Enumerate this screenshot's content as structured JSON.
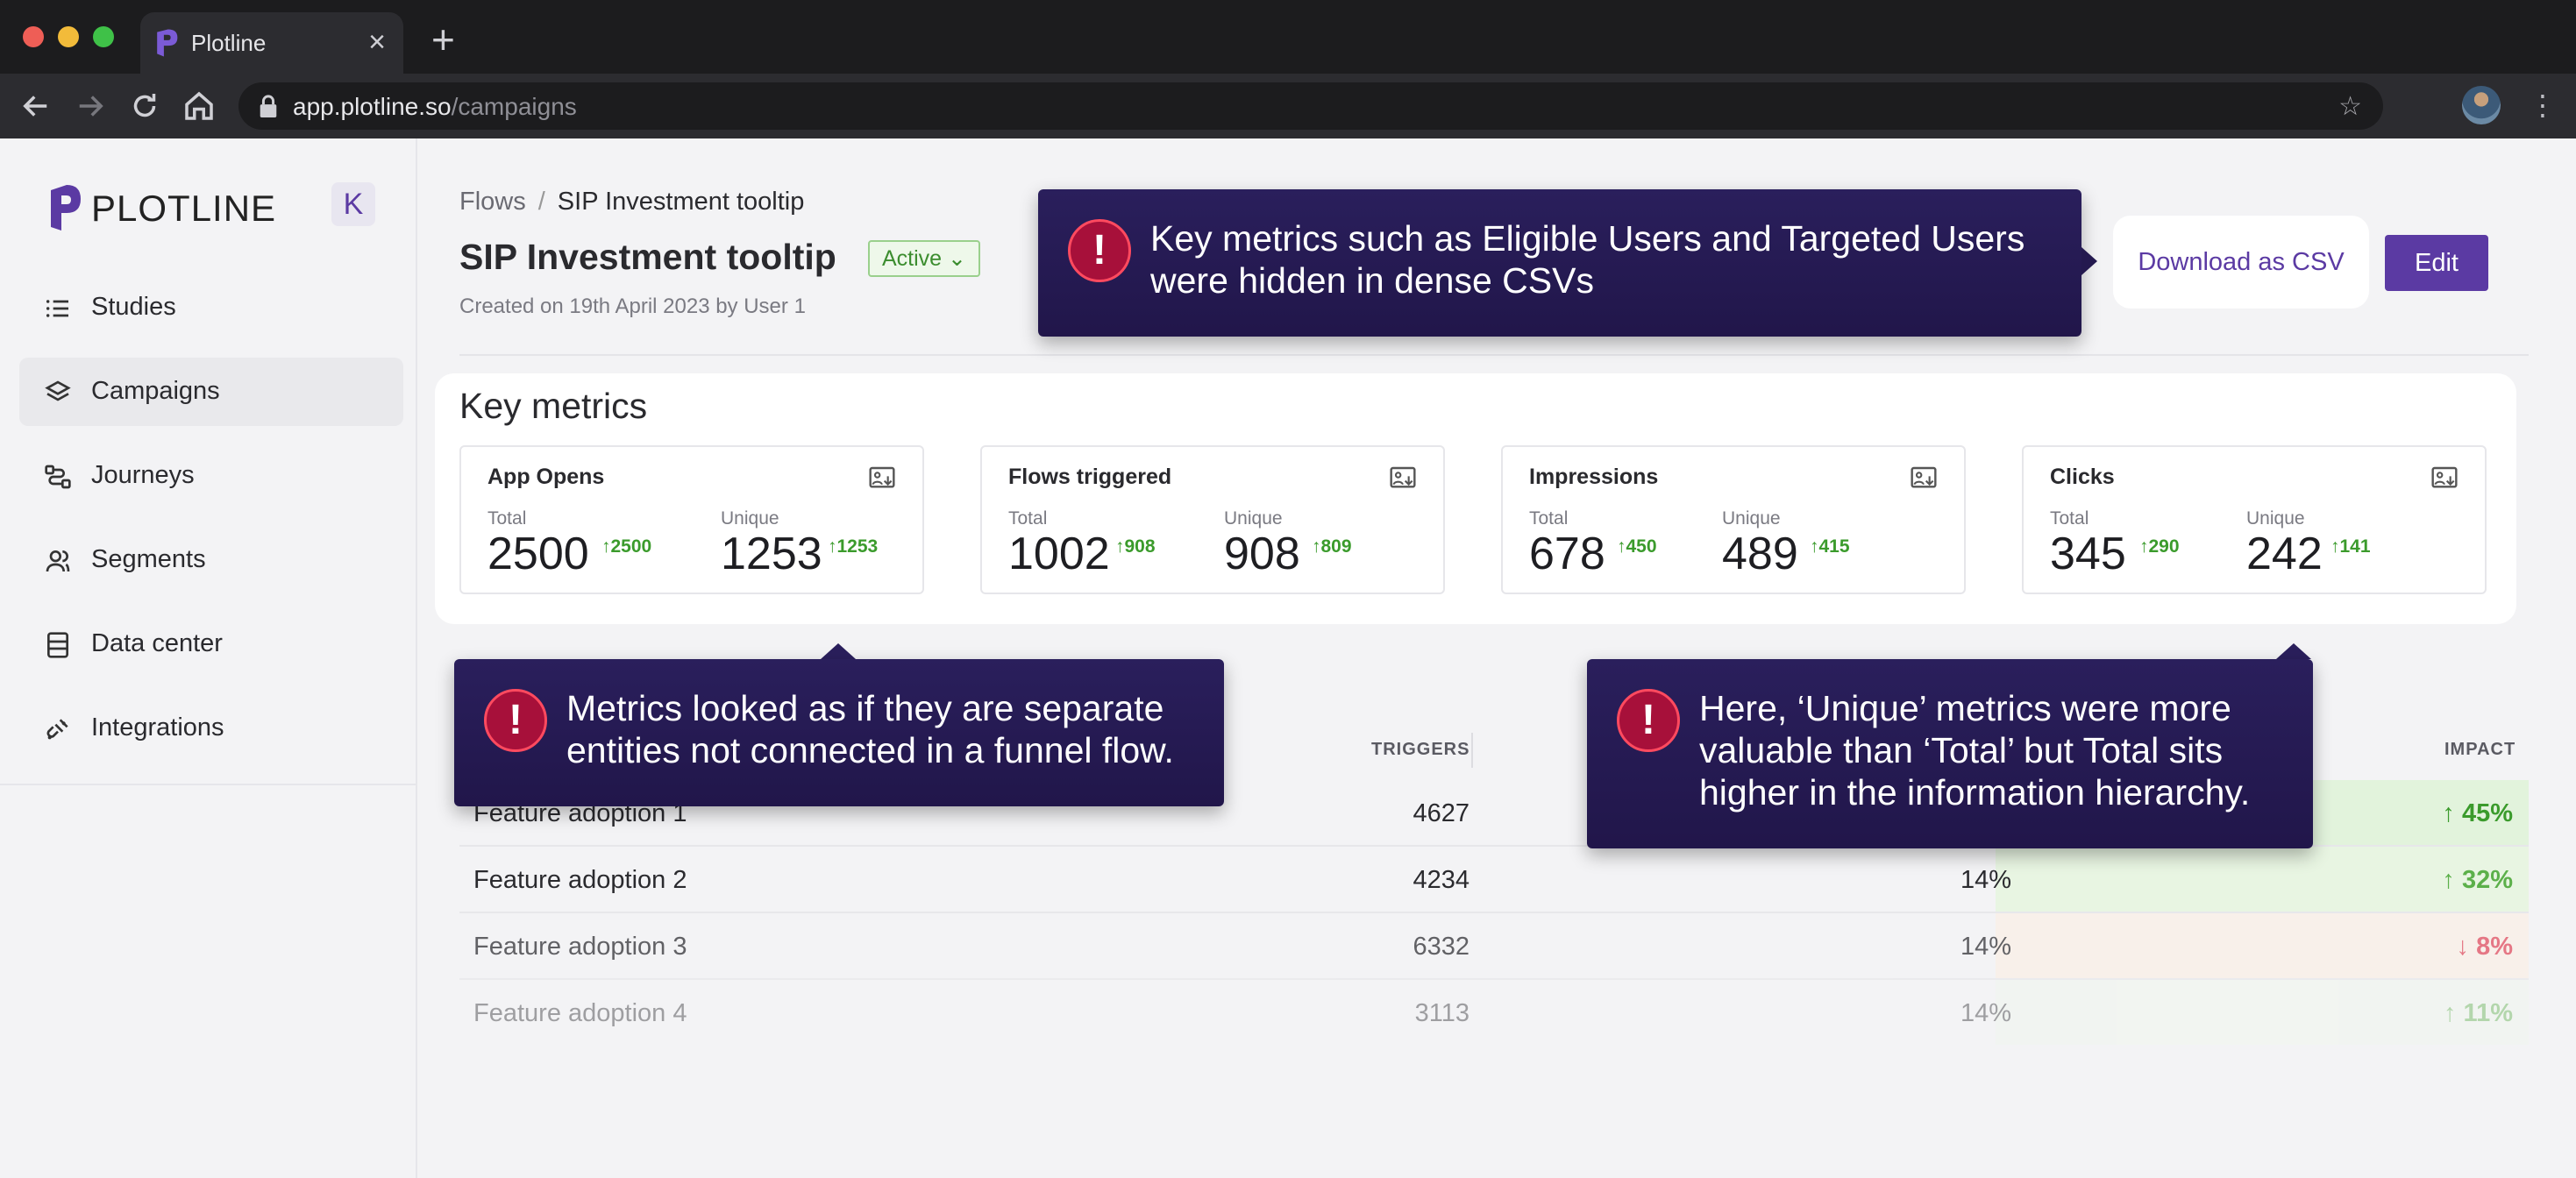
{
  "browser": {
    "tab_title": "Plotline",
    "url_host": "app.plotline.so",
    "url_path": "/campaigns"
  },
  "brand": {
    "logo_text": "PLOTLINE",
    "accent": "#5b3aa3"
  },
  "sidebar": {
    "collapse_label": "K",
    "items": [
      {
        "label": "Studies",
        "icon": "list-icon"
      },
      {
        "label": "Campaigns",
        "icon": "layers-icon"
      },
      {
        "label": "Journeys",
        "icon": "journey-icon"
      },
      {
        "label": "Segments",
        "icon": "users-icon"
      },
      {
        "label": "Data center",
        "icon": "database-icon"
      },
      {
        "label": "Integrations",
        "icon": "plug-icon"
      }
    ]
  },
  "header": {
    "breadcrumb_root": "Flows",
    "breadcrumb_sep": "/",
    "breadcrumb_current": "SIP Investment tooltip",
    "title": "SIP Investment tooltip",
    "status": "Active",
    "created": "Created on 19th April 2023 by User 1",
    "download_label": "Download as CSV",
    "edit_label": "Edit"
  },
  "metrics": {
    "title": "Key metrics",
    "total_label": "Total",
    "unique_label": "Unique",
    "cards": [
      {
        "name": "App Opens",
        "total": "2500",
        "total_delta": "2500",
        "unique": "1253",
        "unique_delta": "1253"
      },
      {
        "name": "Flows triggered",
        "total": "1002",
        "total_delta": "908",
        "unique": "908",
        "unique_delta": "809"
      },
      {
        "name": "Impressions",
        "total": "678",
        "total_delta": "450",
        "unique": "489",
        "unique_delta": "415"
      },
      {
        "name": "Clicks",
        "total": "345",
        "total_delta": "290",
        "unique": "242",
        "unique_delta": "141"
      }
    ]
  },
  "table": {
    "col_triggers": "TRIGGERS",
    "col_impact": "IMPACT",
    "rows": [
      {
        "name": "Feature adoption 1",
        "triggers": "4627",
        "rate": "",
        "impact": "45%",
        "direction": "up"
      },
      {
        "name": "Feature adoption 2",
        "triggers": "4234",
        "rate": "14%",
        "impact": "32%",
        "direction": "up"
      },
      {
        "name": "Feature adoption 3",
        "triggers": "6332",
        "rate": "14%",
        "impact": "8%",
        "direction": "down"
      },
      {
        "name": "Feature adoption 4",
        "triggers": "3113",
        "rate": "14%",
        "impact": "11%",
        "direction": "up"
      }
    ]
  },
  "callouts": {
    "csv": "Key metrics such as Eligible Users and Targeted Users were hidden in dense CSVs",
    "funnel": "Metrics looked as if they are separate entities not connected in a funnel flow.",
    "unique": "Here, ‘Unique’ metrics were more valuable than ‘Total’ but Total sits higher in the information hierarchy.",
    "icon_glyph": "!"
  }
}
